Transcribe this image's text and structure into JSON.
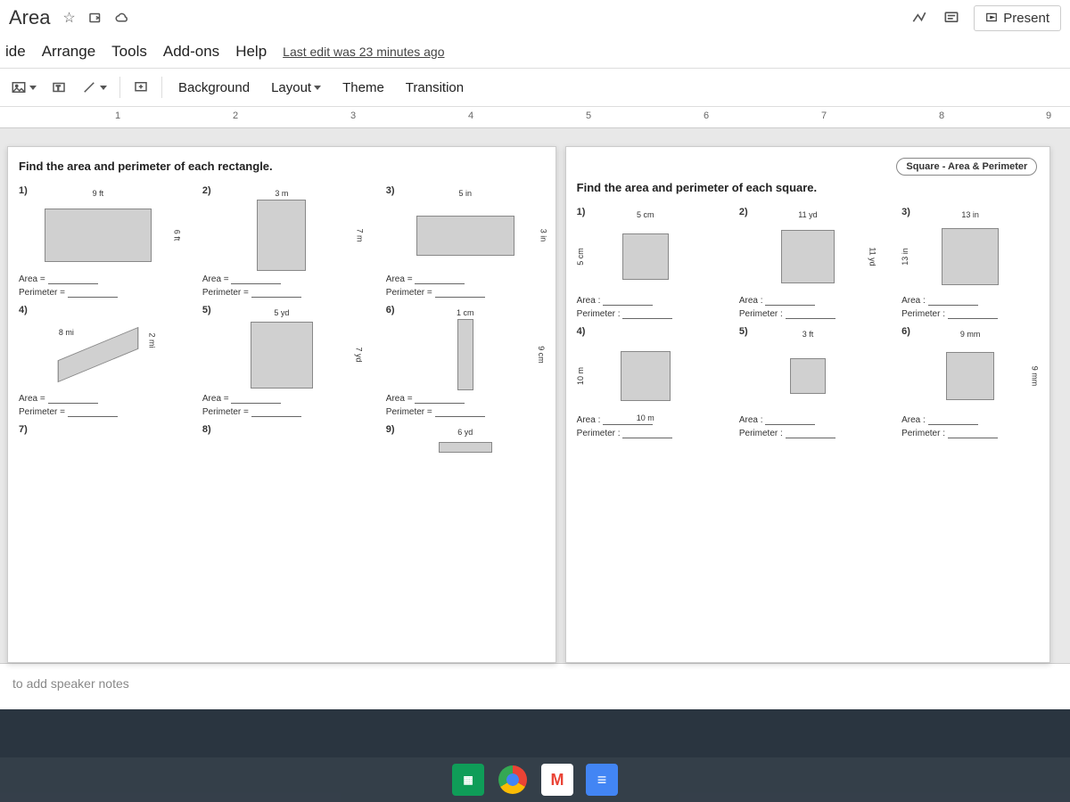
{
  "title": "Area",
  "menu": {
    "slide": "ide",
    "arrange": "Arrange",
    "tools": "Tools",
    "addons": "Add-ons",
    "help": "Help"
  },
  "last_edit": "Last edit was 23 minutes ago",
  "toolbar": {
    "background": "Background",
    "layout": "Layout",
    "theme": "Theme",
    "transition": "Transition"
  },
  "present_label": "Present",
  "ruler_nums": [
    "1",
    "2",
    "3",
    "4",
    "5",
    "6",
    "7",
    "8",
    "9"
  ],
  "left_slide": {
    "heading": "Find the area and perimeter of each rectangle.",
    "problems": [
      {
        "n": "1)",
        "top": "9 ft",
        "right": "6 ft"
      },
      {
        "n": "2)",
        "top": "3 m",
        "right": "7 m"
      },
      {
        "n": "3)",
        "top": "5 in",
        "right": "3 in"
      },
      {
        "n": "4)",
        "top": "8 mi",
        "right": "2 mi"
      },
      {
        "n": "5)",
        "top": "5 yd",
        "right": "7 yd"
      },
      {
        "n": "6)",
        "top": "1 cm",
        "right": "9 cm"
      },
      {
        "n": "7)",
        "top": "",
        "right": ""
      },
      {
        "n": "8)",
        "top": "",
        "right": ""
      },
      {
        "n": "9)",
        "top": "6 yd",
        "right": ""
      }
    ],
    "labels": {
      "area": "Area",
      "perimeter": "Perimeter",
      "eq": "="
    }
  },
  "right_slide": {
    "tag": "Square - Area & Perimeter",
    "heading": "Find the area and perimeter of each square.",
    "problems": [
      {
        "n": "1)",
        "top": "5 cm",
        "side": "5 cm"
      },
      {
        "n": "2)",
        "top": "11 yd",
        "side": "11 yd"
      },
      {
        "n": "3)",
        "top": "13 in",
        "side": "13 in"
      },
      {
        "n": "4)",
        "top": "10 m",
        "side": "10 m"
      },
      {
        "n": "5)",
        "top": "3 ft",
        "side": ""
      },
      {
        "n": "6)",
        "top": "9 mm",
        "side": "9 mm"
      }
    ],
    "labels": {
      "area": "Area :",
      "perimeter": "Perimeter :"
    }
  },
  "notes_placeholder": "to add speaker notes"
}
